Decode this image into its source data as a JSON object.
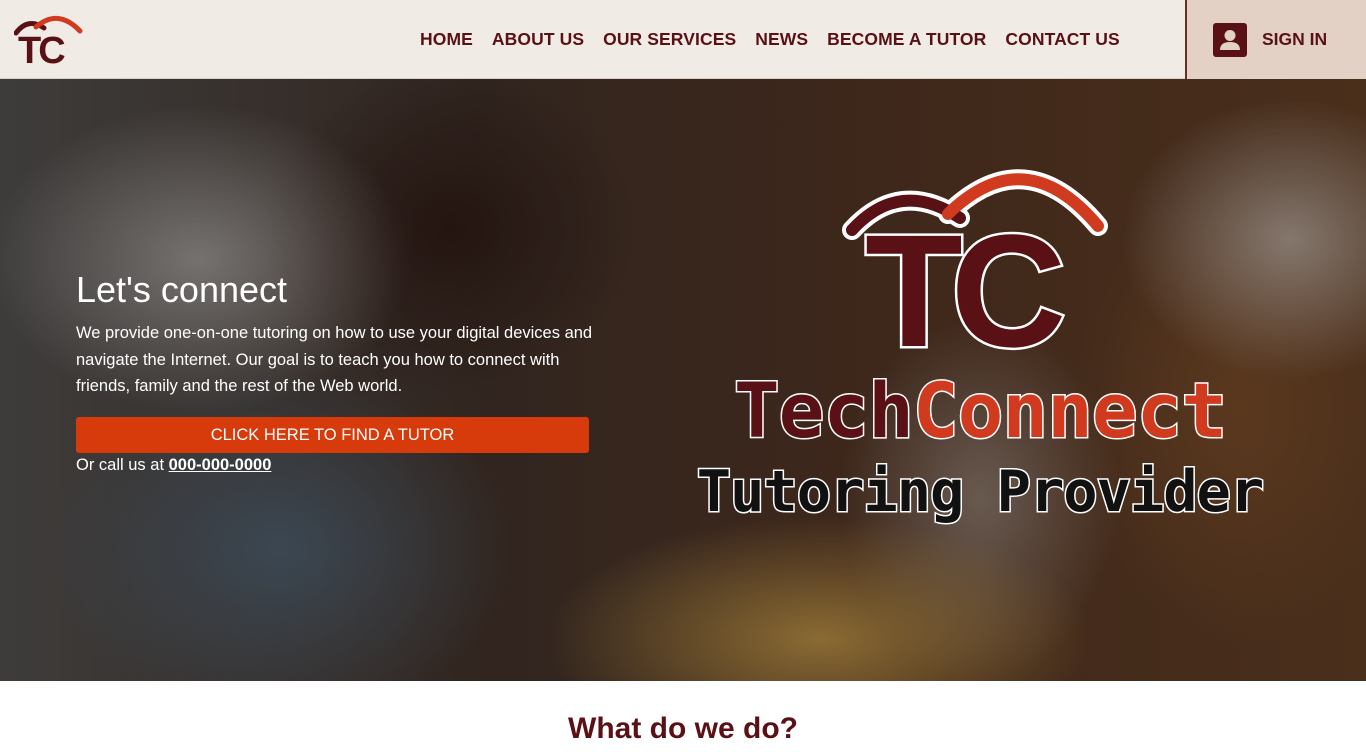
{
  "header": {
    "logo_text": "TC",
    "nav": [
      {
        "label": "HOME"
      },
      {
        "label": "ABOUT US"
      },
      {
        "label": "OUR SERVICES"
      },
      {
        "label": "NEWS"
      },
      {
        "label": "BECOME A TUTOR"
      },
      {
        "label": "CONTACT US"
      }
    ],
    "signin": {
      "label": "SIGN IN",
      "icon": "user-icon"
    }
  },
  "hero": {
    "title": "Let's connect",
    "description": "We provide one-on-one tutoring on how to use your digital devices and navigate the Internet. Our goal is to teach you how to connect with friends, family and the rest of the Web world.",
    "cta_label": "CLICK HERE TO FIND A TUTOR",
    "call_prefix": "Or call us at ",
    "phone": "000-000-0000",
    "brand": {
      "logo_text": "TC",
      "name_part1": "Tech",
      "name_part2": "Connect",
      "subtitle": "Tutoring Provider"
    }
  },
  "section": {
    "title": "What do we do?"
  },
  "colors": {
    "header_bg": "#f1ebe6",
    "nav_text": "#5a1116",
    "signin_bg": "#e3d1c6",
    "cta_bg": "#d83b0b",
    "brand_maroon": "#5a1116",
    "brand_orange": "#d03a1f"
  }
}
